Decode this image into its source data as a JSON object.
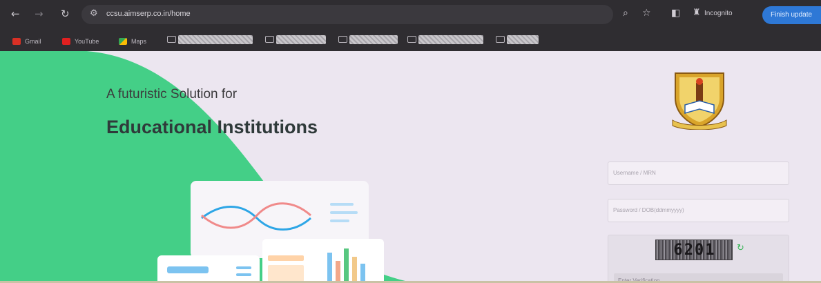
{
  "browser": {
    "url": "ccsu.aimserp.co.in/home",
    "incognito_label": "Incognito",
    "finish_update_label": "Finish update"
  },
  "bookmarks": [
    {
      "label": "Gmail",
      "color": "#d93025"
    },
    {
      "label": "YouTube",
      "color": "#e02020"
    },
    {
      "label": "Maps",
      "color": "#34a853"
    }
  ],
  "hero": {
    "tagline": "A futuristic Solution for",
    "headline": "Educational Institutions"
  },
  "login": {
    "username_placeholder": "Username / MRN",
    "password_placeholder": "Password / DOB(ddmmyyyy)",
    "captcha_text": "6201",
    "captcha_placeholder": "Enter Verification"
  },
  "colors": {
    "accent_green": "#3fcf87",
    "browser_dark": "#2f2d31",
    "update_blue": "#2e78d6"
  }
}
